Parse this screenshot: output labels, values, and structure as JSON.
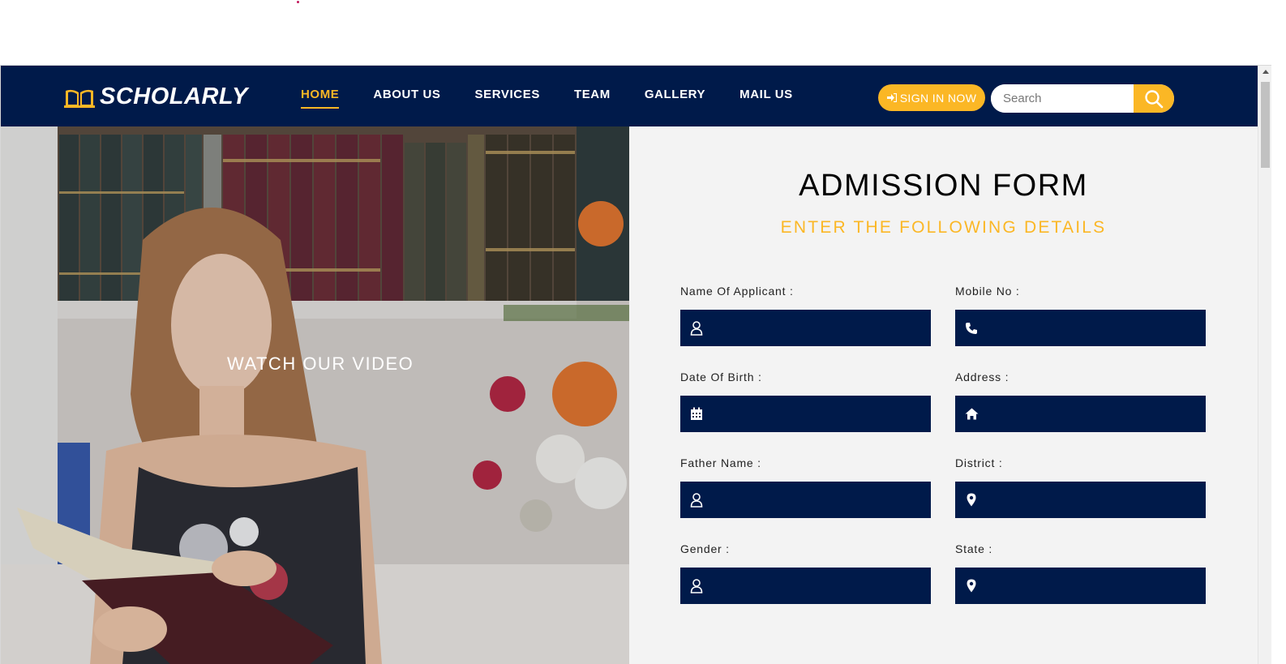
{
  "header": {
    "logo_text": "SCHOLARLY",
    "nav": [
      {
        "label": "HOME",
        "active": true
      },
      {
        "label": "ABOUT US",
        "active": false
      },
      {
        "label": "SERVICES",
        "active": false
      },
      {
        "label": "TEAM",
        "active": false
      },
      {
        "label": "GALLERY",
        "active": false
      },
      {
        "label": "MAIL US",
        "active": false
      }
    ],
    "signin_label": "SIGN IN NOW",
    "search_placeholder": "Search"
  },
  "hero": {
    "video_label": "WATCH OUR VIDEO"
  },
  "form": {
    "title": "ADMISSION FORM",
    "subtitle": "ENTER THE FOLLOWING DETAILS",
    "fields": [
      {
        "label": "Name Of Applicant :",
        "icon": "user-icon",
        "value": ""
      },
      {
        "label": "Mobile No :",
        "icon": "phone-icon",
        "value": ""
      },
      {
        "label": "Date Of Birth :",
        "icon": "calendar-icon",
        "value": ""
      },
      {
        "label": "Address :",
        "icon": "home-icon",
        "value": ""
      },
      {
        "label": "Father Name :",
        "icon": "user-icon",
        "value": ""
      },
      {
        "label": "District :",
        "icon": "map-marker-icon",
        "value": ""
      },
      {
        "label": "Gender :",
        "icon": "user-icon",
        "value": ""
      },
      {
        "label": "State :",
        "icon": "map-marker-icon",
        "value": ""
      }
    ]
  },
  "colors": {
    "navy": "#001a4a",
    "accent": "#fbb725",
    "panel_bg": "#f3f3f3"
  }
}
